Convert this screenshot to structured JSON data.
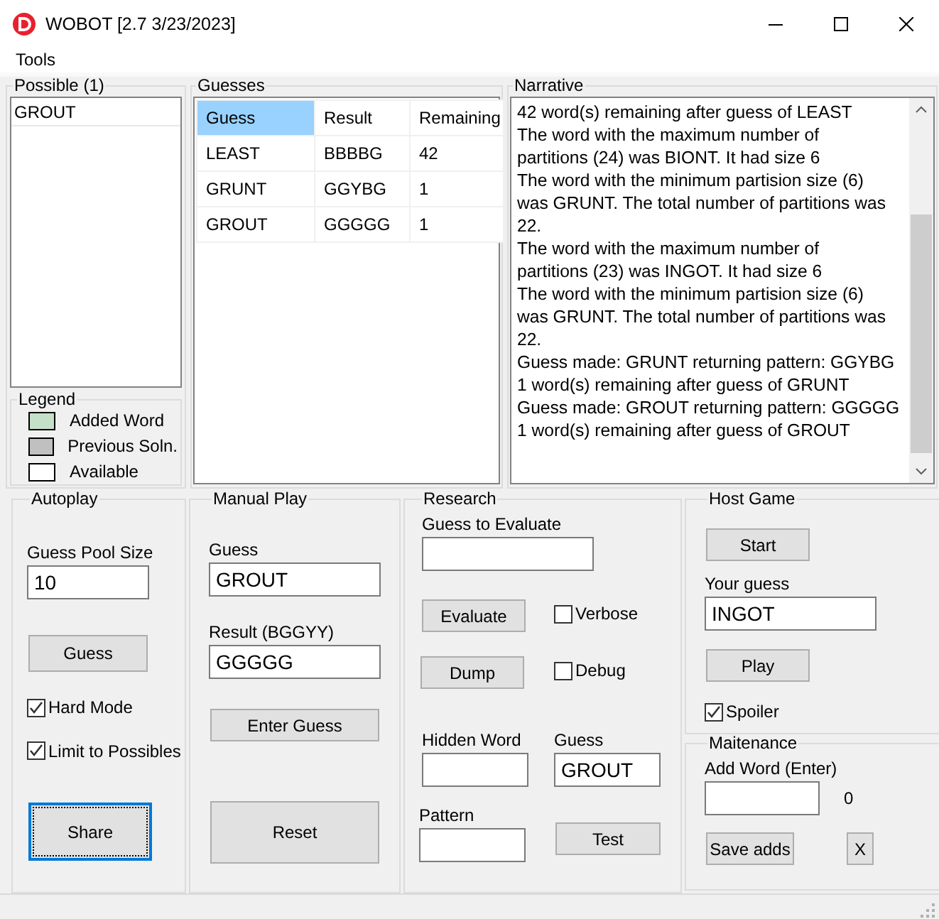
{
  "window": {
    "title": "WOBOT [2.7 3/23/2023]"
  },
  "menu": [
    {
      "label": "Tools"
    }
  ],
  "possible": {
    "title": "Possible (1)",
    "items": [
      "GROUT"
    ]
  },
  "legend": {
    "title": "Legend",
    "items": [
      {
        "label": "Added Word",
        "color": "#c5e0c8"
      },
      {
        "label": "Previous Soln.",
        "color": "#c0c0c0"
      },
      {
        "label": "Available",
        "color": "#ffffff"
      }
    ]
  },
  "guesses": {
    "title": "Guesses",
    "columns": [
      {
        "label": "Guess",
        "selected": true
      },
      {
        "label": "Result",
        "selected": false
      },
      {
        "label": "Remaining",
        "selected": false
      }
    ],
    "rows": [
      [
        "LEAST",
        "BBBBG",
        "42"
      ],
      [
        "GRUNT",
        "GGYBG",
        "1"
      ],
      [
        "GROUT",
        "GGGGG",
        "1"
      ]
    ]
  },
  "narrative": {
    "title": "Narrative",
    "lines": [
      "42 word(s) remaining after guess of LEAST",
      "The word with the maximum number of",
      "partitions (24) was BIONT. It had size 6",
      "The word with the minimum partision size (6)",
      "was GRUNT. The total number of partitions was",
      "22.",
      "The word with the maximum number of",
      "partitions (23) was INGOT. It had size 6",
      "The word with the minimum partision size (6)",
      "was GRUNT. The total number of partitions was",
      "22.",
      "Guess made: GRUNT returning pattern: GGYBG",
      "1 word(s) remaining after guess of GRUNT",
      "Guess made: GROUT returning pattern: GGGGG",
      "1 word(s) remaining after guess of GROUT"
    ]
  },
  "autoplay": {
    "title": "Autoplay",
    "pool_label": "Guess Pool Size",
    "pool_value": "10",
    "guess_button": "Guess",
    "checks": [
      {
        "label": "Hard Mode",
        "checked": true
      },
      {
        "label": "Limit to Possibles",
        "checked": true
      }
    ],
    "share_button": {
      "label": "Share",
      "focused": true
    }
  },
  "manual": {
    "title": "Manual Play",
    "guess_label": "Guess",
    "guess_value": "GROUT",
    "result_label": "Result (BGGYY)",
    "result_value": "GGGGG",
    "enter_button": "Enter Guess",
    "reset_button": "Reset"
  },
  "research": {
    "title": "Research",
    "evaluate_label": "Guess to Evaluate",
    "evaluate_button": "Evaluate",
    "verbose": {
      "label": "Verbose",
      "checked": false
    },
    "dump_button": "Dump",
    "debug": {
      "label": "Debug",
      "checked": false
    },
    "hidden_label": "Hidden Word",
    "guess_label": "Guess",
    "guess_value": "GROUT",
    "pattern_label": "Pattern",
    "test_button": "Test"
  },
  "host": {
    "title": "Host Game",
    "start_button": "Start",
    "guess_label": "Your guess",
    "guess_value": "INGOT",
    "play_button": "Play",
    "spoiler": {
      "label": "Spoiler",
      "checked": true
    }
  },
  "maintenance": {
    "title": "Maitenance",
    "add_label": "Add Word (Enter)",
    "count": "0",
    "save_button": "Save adds",
    "clear_button": "X"
  }
}
